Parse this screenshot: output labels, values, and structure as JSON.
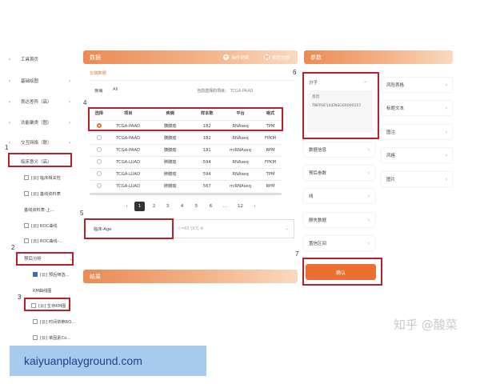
{
  "sidebar": {
    "items": [
      {
        "label": "工具首页",
        "expand": "‹",
        "right": ""
      },
      {
        "label": "基础绘图",
        "expand": "‹",
        "right": "›"
      },
      {
        "label": "表达差异（高）",
        "expand": "‹",
        "right": "›"
      },
      {
        "label": "功能聚类（图）",
        "expand": "‹",
        "right": "›"
      },
      {
        "label": "交互网络（联）",
        "expand": "‹",
        "right": "›"
      },
      {
        "label": "临床意义（高）",
        "expand": "‹",
        "right": "⌄"
      }
    ],
    "clinical_subitems": [
      {
        "label": "[云] 临床相关性"
      },
      {
        "label": "[云] 基线资料表"
      },
      {
        "label": "基线资料表-上..."
      },
      {
        "label": "[云] ROC曲线"
      },
      {
        "label": "[云] ROC曲线-..."
      }
    ],
    "prognosis": {
      "label": "预后分析",
      "right": "⌄"
    },
    "prognosis_subitems": [
      {
        "label": "[云] 预后筛选..."
      },
      {
        "label": "KM曲线图"
      },
      {
        "label": "[云] 生存KM图"
      },
      {
        "label": "[云] 时间依赖RO..."
      },
      {
        "label": "[云] 单因素Co..."
      }
    ]
  },
  "data_panel": {
    "title": "数据",
    "action_update": "操作说明",
    "action_docs": "教程文档",
    "tab_label": "云端数据",
    "filter_label": "疾病",
    "filter_value": "All",
    "current_label": "当前选择的项目：",
    "current_value": "TCGA-PAAD",
    "table": {
      "headers": [
        "选择",
        "项目",
        "疾病",
        "样本数",
        "平台",
        "格式"
      ],
      "rows": [
        [
          "TCGA-PAAD",
          "胰腺癌",
          "182",
          "RNAseq",
          "TPM"
        ],
        [
          "TCGA-PAAD",
          "胰腺癌",
          "182",
          "RNAseq",
          "FPKM"
        ],
        [
          "TCGA-PAAD",
          "胰腺癌",
          "181",
          "miRNAseq",
          "RPM"
        ],
        [
          "TCGA-LUAD",
          "肺腺癌",
          "594",
          "RNAseq",
          "FPKM"
        ],
        [
          "TCGA-LUAD",
          "肺腺癌",
          "594",
          "RNAseq",
          "TPM"
        ],
        [
          "TCGA-LUAD",
          "肺腺癌",
          "567",
          "miRNAseq",
          "RPM"
        ]
      ]
    },
    "pagination": [
      "‹",
      "1",
      "2",
      "3",
      "4",
      "5",
      "6",
      "...",
      "12",
      "›"
    ],
    "clinical_field": "临床-Age",
    "clinical_threshold": "<=65 [93] ⊗"
  },
  "result_panel": {
    "title": "结果"
  },
  "params_panel": {
    "title": "参数",
    "molecule": {
      "label": "分子",
      "subtitle": "基因",
      "value": "TNFRSF14|ENSG00000157"
    },
    "left_cards": [
      "数据信息",
      "预后参数",
      "线",
      "删失数据",
      "置信区间"
    ],
    "right_cards": [
      "风险表格",
      "标题文本",
      "图注",
      "风格",
      "图片"
    ],
    "confirm_label": "确认"
  },
  "annotations": [
    "1",
    "2",
    "3",
    "4",
    "5",
    "6",
    "7"
  ],
  "watermark": "知乎 @酸菜",
  "footer": "kaiyuanplayground.com",
  "colors": {
    "accent": "#ec8a55",
    "highlight": "#b8202a",
    "confirm": "#ec6f32"
  }
}
